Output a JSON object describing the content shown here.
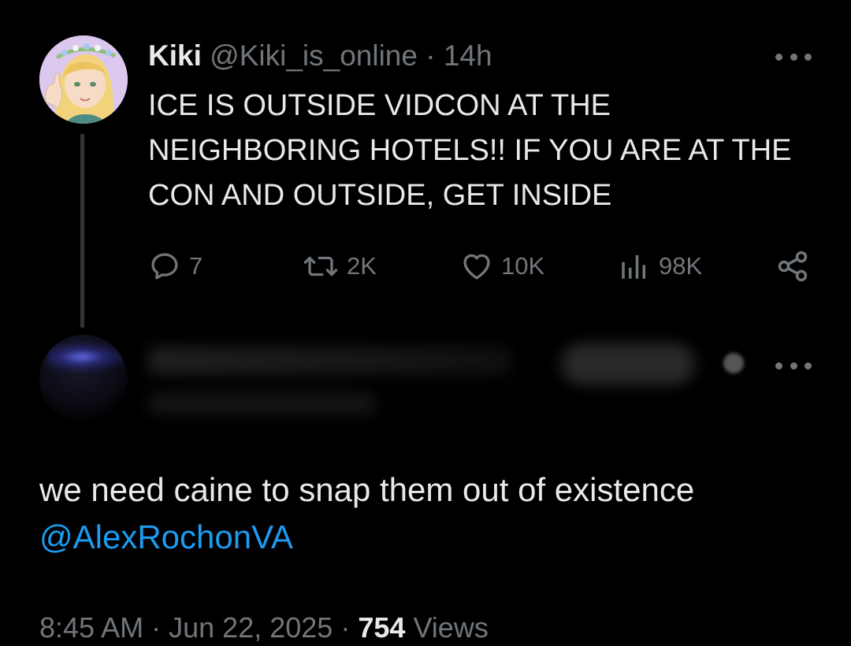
{
  "tweet": {
    "display_name": "Kiki",
    "handle": "@Kiki_is_online",
    "separator": "·",
    "time_ago": "14h",
    "text": "ICE IS OUTSIDE VIDCON AT THE NEIGHBORING HOTELS!! IF YOU ARE AT THE CON AND OUTSIDE, GET INSIDE",
    "stats": {
      "replies": "7",
      "retweets": "2K",
      "likes": "10K",
      "views": "98K"
    },
    "icons": {
      "reply": "reply-icon",
      "retweet": "retweet-icon",
      "like": "heart-icon",
      "views": "views-icon",
      "share": "share-icon",
      "more": "more-icon"
    }
  },
  "reply": {
    "text": "we need caine to snap them out of existence",
    "mention": "@AlexRochonVA",
    "time": "8:45 AM",
    "date": "Jun 22, 2025",
    "separator": "·",
    "views_count": "754",
    "views_label": "Views"
  },
  "colors": {
    "background": "#000000",
    "text": "#e7e9ea",
    "muted": "#71767b",
    "link": "#1d9bf0"
  }
}
